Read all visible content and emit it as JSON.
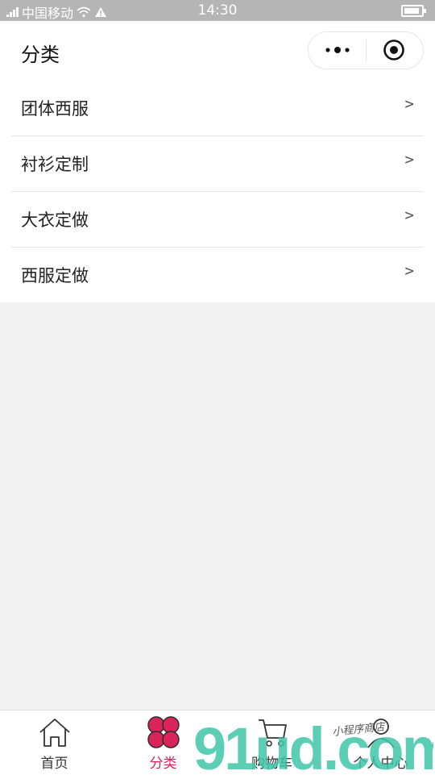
{
  "status_bar": {
    "carrier": "中国移动",
    "time": "14:30"
  },
  "header": {
    "title": "分类",
    "more_icon": "more-dots-icon",
    "close_icon": "target-close-icon"
  },
  "categories": [
    {
      "label": "团体西服",
      "arrow": ">"
    },
    {
      "label": "衬衫定制",
      "arrow": ">"
    },
    {
      "label": "大衣定做",
      "arrow": ">"
    },
    {
      "label": "西服定做",
      "arrow": ">"
    }
  ],
  "tab_bar": {
    "active_color": "#d9245a",
    "tabs": [
      {
        "label": "首页",
        "icon": "home-icon",
        "active": false
      },
      {
        "label": "分类",
        "icon": "clover-icon",
        "active": true
      },
      {
        "label": "购物车",
        "icon": "cart-icon",
        "active": false
      },
      {
        "label": "个人中心",
        "icon": "user-icon",
        "active": false
      }
    ]
  },
  "watermark": {
    "text": "91ud.com",
    "tagline": "小程序商店"
  }
}
